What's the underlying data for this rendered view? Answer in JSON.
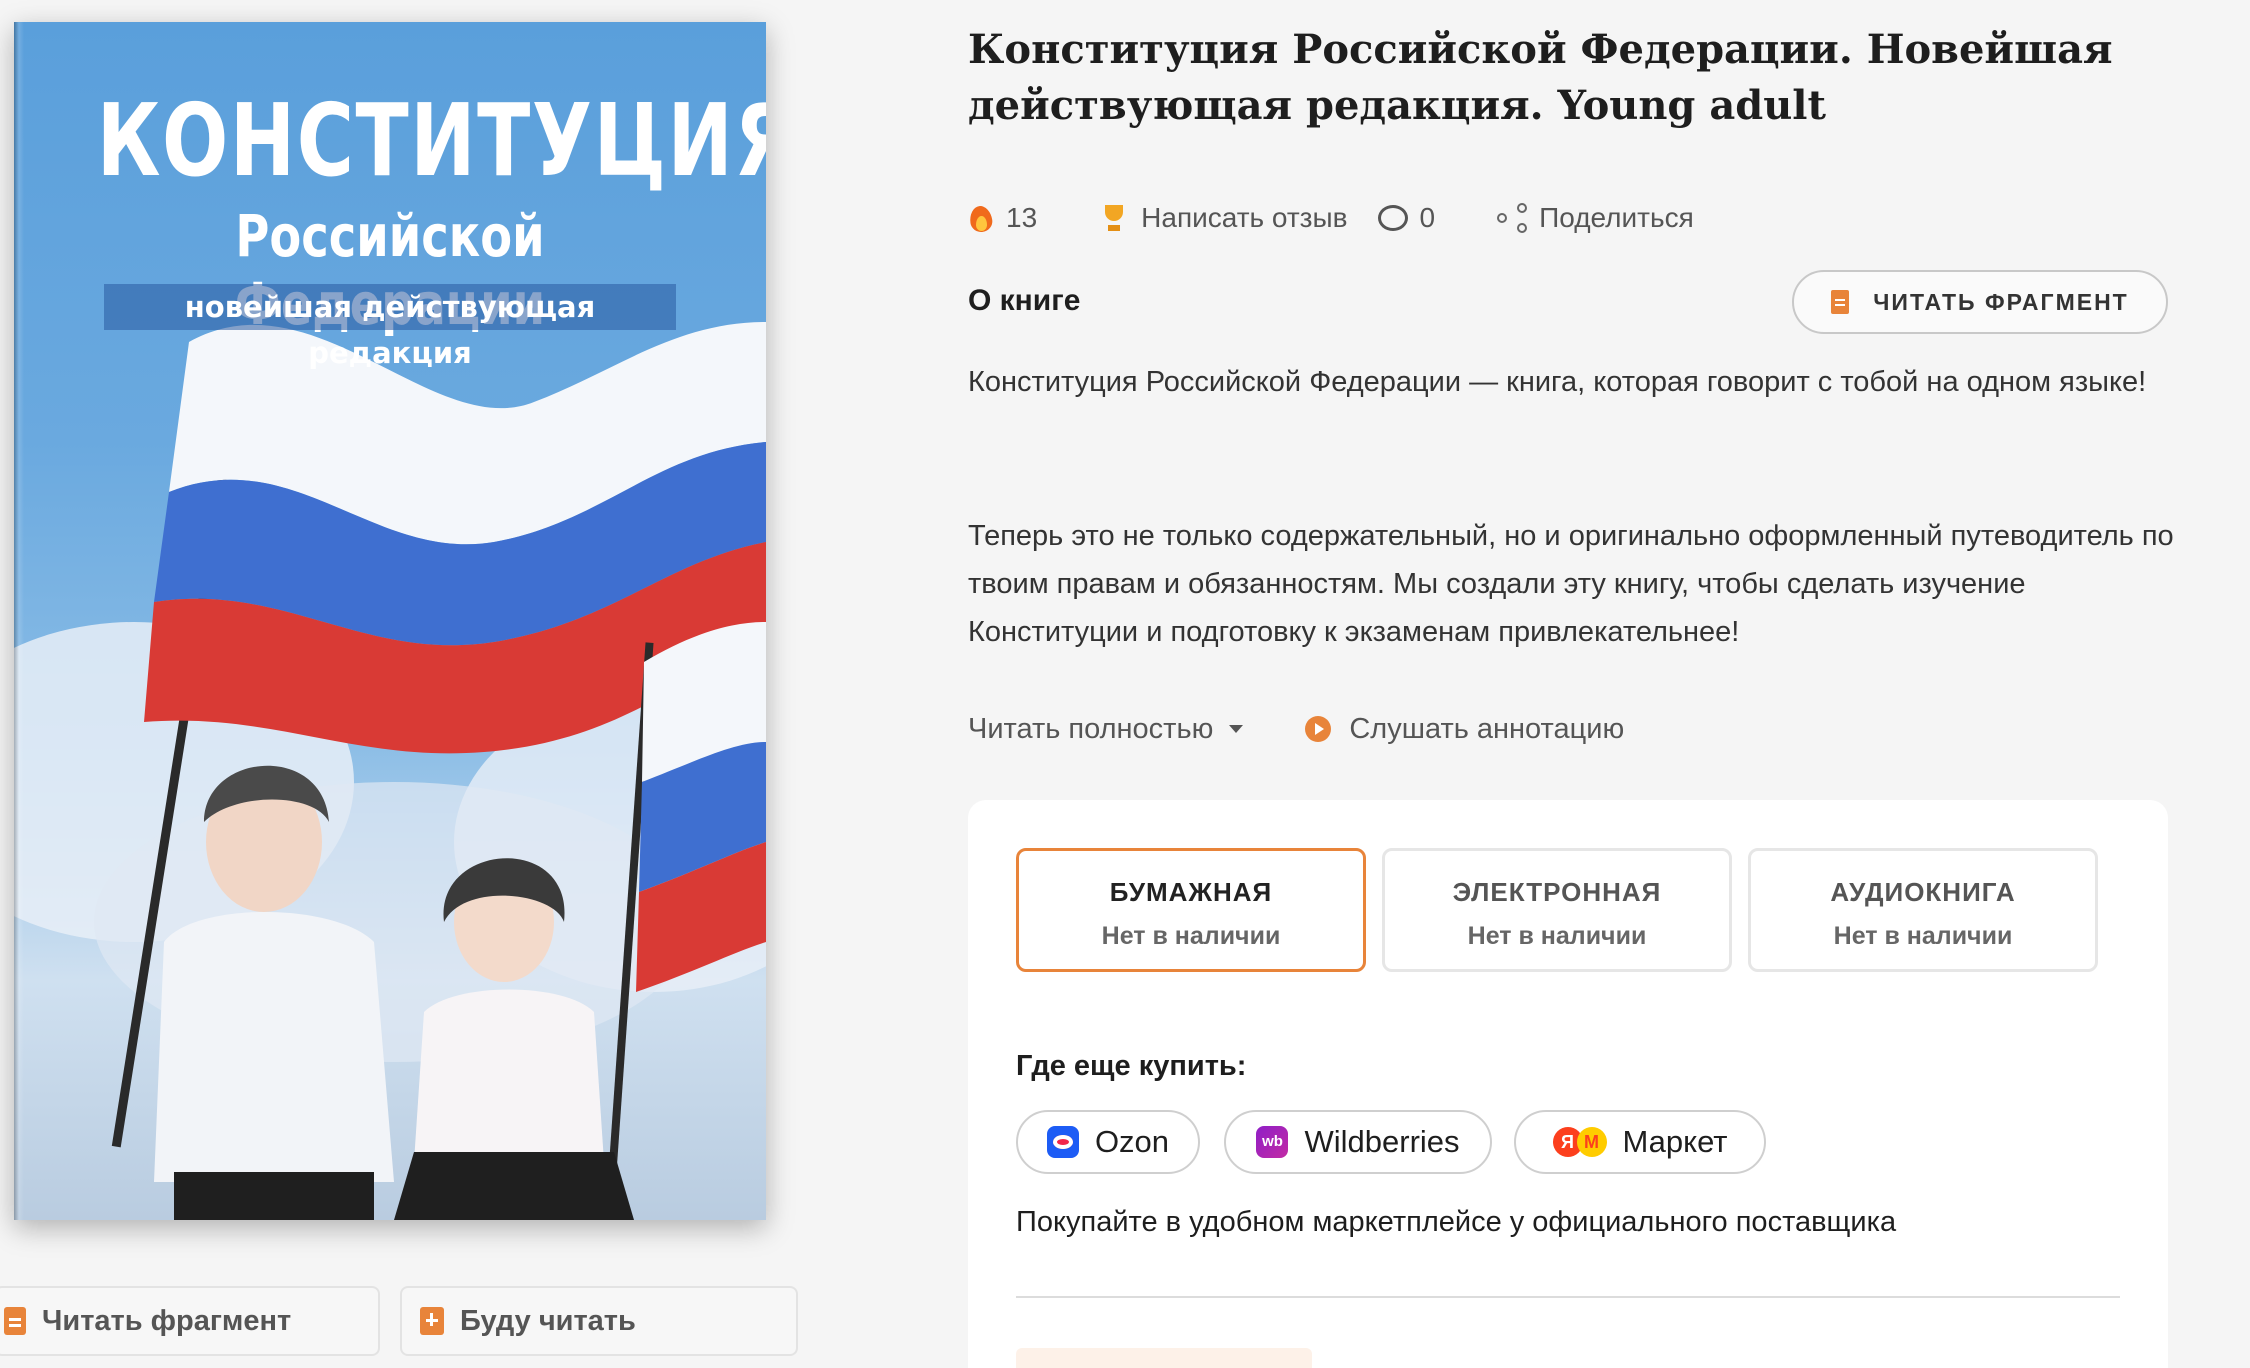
{
  "cover": {
    "title_line1": "КОНСТИТУЦИЯ",
    "title_line2": "Российской Федерации",
    "title_line3": "новейшая действующая редакция"
  },
  "side_buttons": {
    "read_fragment": "Читать фрагмент",
    "will_read": "Буду читать"
  },
  "book": {
    "title": "Конституция Российской Федерации. Новейшая действующая редакция. Young adult"
  },
  "stats": {
    "likes": "13",
    "write_review": "Написать отзыв",
    "comments": "0",
    "share": "Поделиться"
  },
  "about": {
    "label": "О книге",
    "read_fragment_button": "ЧИТАТЬ ФРАГМЕНТ",
    "paragraph1": "Конституция Российской Федерации — книга, которая говорит с тобой на одном языке!",
    "paragraph2": "Теперь это не только содержательный, но и оригинально оформленный путеводитель по твоим правам и обязанностям. Мы создали эту книгу, чтобы сделать изучение Конституции и подготовку к экзаменам привлекательнее!",
    "read_full": "Читать полностью",
    "listen": "Слушать аннотацию"
  },
  "formats": [
    {
      "name": "БУМАЖНАЯ",
      "status": "Нет в наличии",
      "active": true
    },
    {
      "name": "ЭЛЕКТРОННАЯ",
      "status": "Нет в наличии",
      "active": false
    },
    {
      "name": "АУДИОКНИГА",
      "status": "Нет в наличии",
      "active": false
    }
  ],
  "where_to_buy": {
    "label": "Где еще купить:",
    "shops": [
      "Ozon",
      "Wildberries",
      "Маркет"
    ],
    "note": "Покупайте в удобном маркетплейсе у официального поставщика"
  },
  "colors": {
    "accent": "#e8843a",
    "background": "#f5f5f5",
    "panel": "#ffffff"
  }
}
